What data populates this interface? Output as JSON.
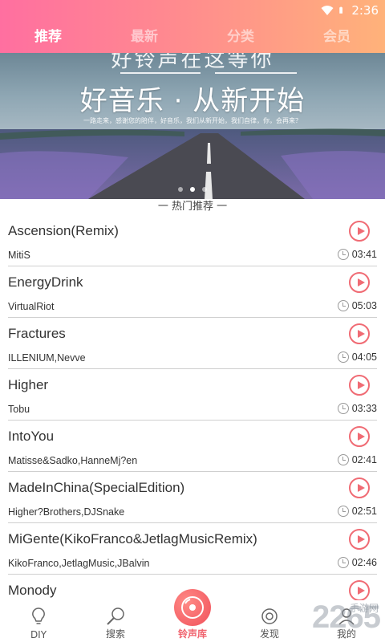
{
  "status": {
    "time": "2:36"
  },
  "tabs": [
    {
      "label": "推荐",
      "active": true
    },
    {
      "label": "最新",
      "active": false
    },
    {
      "label": "分类",
      "active": false
    },
    {
      "label": "会员",
      "active": false
    }
  ],
  "banner": {
    "top_text": "好铃声在这等你",
    "title": "好音乐 · 从新开始",
    "small_text": "一路走来，感谢您的陪伴，好音乐，我们从新开始，我们自律，你，会再来？"
  },
  "section_title": "一 热门推荐 一",
  "songs": [
    {
      "title": "Ascension(Remix)",
      "artist": "MitiS",
      "duration": "03:41"
    },
    {
      "title": "EnergyDrink",
      "artist": "VirtualRiot",
      "duration": "05:03"
    },
    {
      "title": "Fractures",
      "artist": "ILLENIUM,Nevve",
      "duration": "04:05"
    },
    {
      "title": "Higher",
      "artist": "Tobu",
      "duration": "03:33"
    },
    {
      "title": "IntoYou",
      "artist": "Matisse&Sadko,HanneMj?en",
      "duration": "02:41"
    },
    {
      "title": "MadeInChina(SpecialEdition)",
      "artist": "Higher?Brothers,DJSnake",
      "duration": "02:51"
    },
    {
      "title": "MiGente(KikoFranco&JetlagMusicRemix)",
      "artist": "KikoFranco,JetlagMusic,JBalvin",
      "duration": "02:46"
    },
    {
      "title": "Monody",
      "artist": "",
      "duration": ""
    }
  ],
  "bottom_nav": [
    {
      "label": "DIY",
      "icon": "lightbulb-icon"
    },
    {
      "label": "搜索",
      "icon": "search-icon"
    },
    {
      "label": "铃声库",
      "icon": "disc-icon",
      "active": true
    },
    {
      "label": "发现",
      "icon": "discover-icon"
    },
    {
      "label": "我的",
      "icon": "user-icon"
    }
  ],
  "watermark": {
    "text": "2265",
    "sub": "手游网"
  },
  "colors": {
    "accent": "#f06b74",
    "header_start": "#ff6fa0",
    "header_end": "#ffb27a"
  }
}
